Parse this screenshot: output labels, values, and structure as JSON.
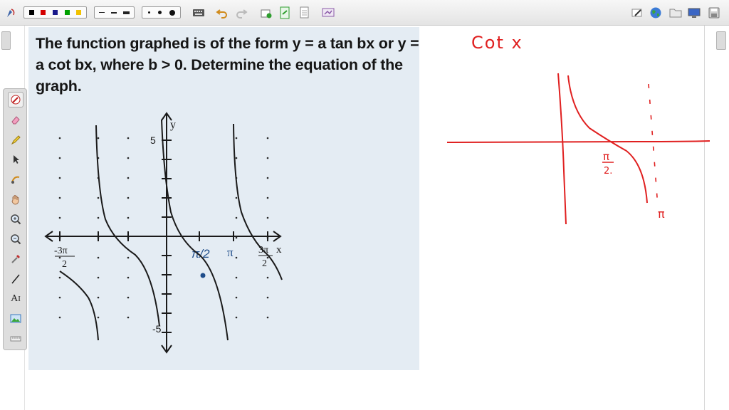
{
  "toolbar": {
    "icons": [
      "pen-settings-icon",
      "color-palette",
      "line-style-group",
      "dot-size-group",
      "keyboard-icon",
      "undo-icon",
      "redo-icon",
      "new-page-icon",
      "green-page-icon",
      "page-icon",
      "screen-capture-icon",
      "edit-icon",
      "globe-icon",
      "folder-icon",
      "monitor-icon",
      "save-icon"
    ],
    "colors": [
      "#000000",
      "#d40000",
      "#1a1a8c",
      "#00a000",
      "#f2c200"
    ]
  },
  "tools": [
    "laser-pen-icon",
    "eraser-icon",
    "highlighter-icon",
    "pointer-icon",
    "shape-icon",
    "hand-icon",
    "zoom-in-icon",
    "zoom-out-icon",
    "pipette-icon",
    "line-icon",
    "text-tool-icon",
    "image-icon",
    "ruler-icon"
  ],
  "text_tool_label": "A",
  "problem": {
    "question": "The function graphed is of the form y = a tan bx or y = a cot bx, where b > 0. Determine the equation of the graph."
  },
  "graph": {
    "axis_y_label": "y",
    "axis_x_label": "x",
    "y_tick_top": "5",
    "y_tick_bottom": "-5",
    "x_labels": [
      {
        "num": "-3π",
        "den": "2"
      },
      {
        "text": "π/2"
      },
      {
        "text": "π"
      },
      {
        "num": "3π",
        "den": "2"
      }
    ],
    "curve_color": "#1a1a1a",
    "annotation_color": "#1f4d8a"
  },
  "handwriting": {
    "title": "Cot x",
    "label_half_pi": {
      "num": "π",
      "den": "2."
    },
    "label_pi": "π",
    "ink_color": "#e02020"
  }
}
